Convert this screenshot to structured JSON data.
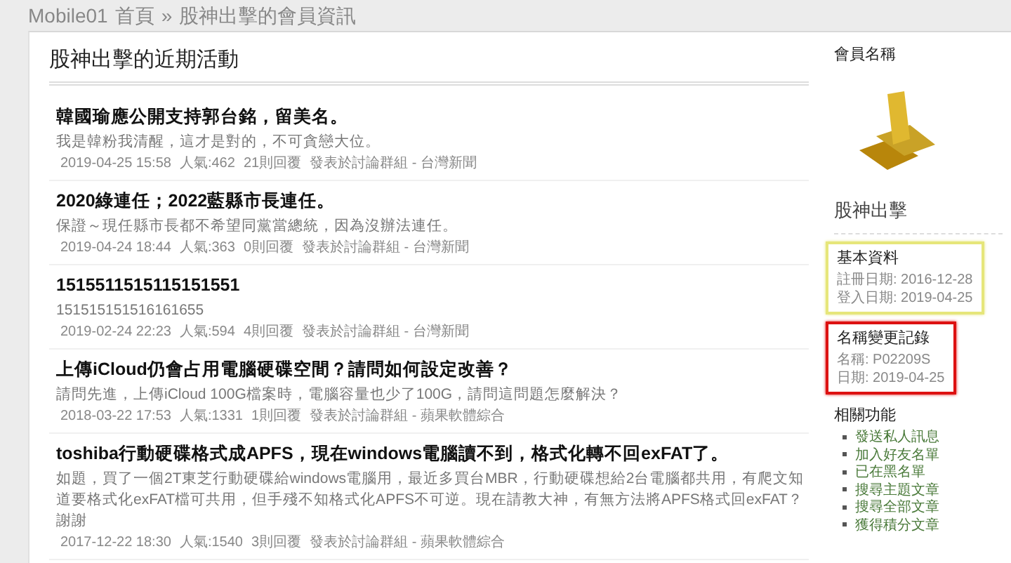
{
  "breadcrumb": {
    "site": "Mobile01",
    "home": "首頁",
    "separator": "»",
    "current": "股神出擊的會員資訊"
  },
  "main": {
    "heading": "股神出擊的近期活動",
    "posts": [
      {
        "title": "韓國瑜應公開支持郭台銘，留美名。",
        "excerpt": "我是韓粉我清醒，這才是對的，不可貪戀大位。",
        "date": "2019-04-25 15:58",
        "views": "人氣:462",
        "replies": "21則回覆",
        "forum": "發表於討論群組 - 台灣新聞"
      },
      {
        "title": "2020綠連任；2022藍縣市長連任。",
        "excerpt": "保證～現任縣市長都不希望同黨當總統，因為沒辦法連任。",
        "date": "2019-04-24 18:44",
        "views": "人氣:363",
        "replies": "0則回覆",
        "forum": "發表於討論群組 - 台灣新聞"
      },
      {
        "title": "1515511515115151551",
        "excerpt": "151515151516161655",
        "date": "2019-02-24 22:23",
        "views": "人氣:594",
        "replies": "4則回覆",
        "forum": "發表於討論群組 - 台灣新聞"
      },
      {
        "title": "上傳iCloud仍會占用電腦硬碟空間？請問如何設定改善？",
        "excerpt": "請問先進，上傳iCloud 100G檔案時，電腦容量也少了100G，請問這問題怎麼解決？",
        "date": "2018-03-22 17:53",
        "views": "人氣:1331",
        "replies": "1則回覆",
        "forum": "發表於討論群組 - 蘋果軟體綜合"
      },
      {
        "title": "toshiba行動硬碟格式成APFS，現在windows電腦讀不到，格式化轉不回exFAT了。",
        "excerpt": "如題，買了一個2T東芝行動硬碟給windows電腦用，最近多買台MBR，行動硬碟想給2台電腦都共用，有爬文知道要格式化exFAT檔可共用，但手殘不知格式化APFS不可逆。現在請教大神，有無方法將APFS格式回exFAT？謝謝",
        "date": "2017-12-22 18:30",
        "views": "人氣:1540",
        "replies": "3則回覆",
        "forum": "發表於討論群組 - 蘋果軟體綜合"
      }
    ]
  },
  "sidebar": {
    "member_label": "會員名稱",
    "member_name": "股神出擊",
    "sections": [
      {
        "title": "基本資料",
        "color": "#e6e67a",
        "lines": [
          "註冊日期: 2016-12-28",
          "登入日期: 2019-04-25"
        ]
      },
      {
        "title": "名稱變更記錄",
        "color": "#dd1111",
        "lines": [
          "名稱: P02209S",
          "日期: 2019-04-25"
        ]
      }
    ],
    "related": {
      "title": "相關功能",
      "links": [
        "發送私人訊息",
        "加入好友名單",
        "已在黑名單",
        "搜尋主題文章",
        "搜尋全部文章",
        "獲得積分文章"
      ]
    }
  }
}
